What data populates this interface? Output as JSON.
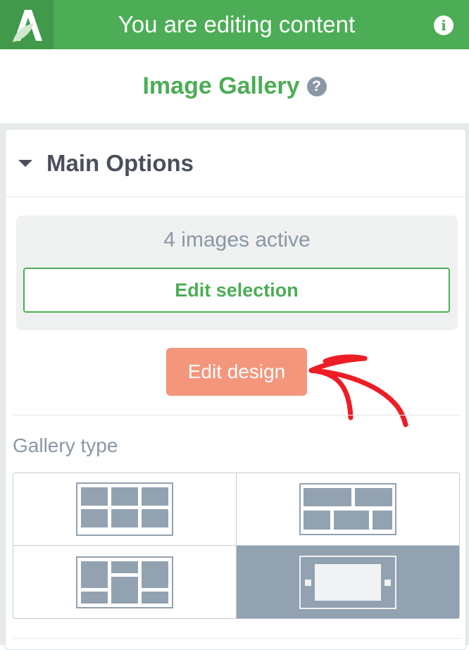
{
  "topbar": {
    "title": "You are editing content",
    "logo_icon": "leaf-a-logo-icon",
    "info_icon": "info-icon"
  },
  "header": {
    "title": "Image Gallery",
    "help_icon": "question-icon",
    "help_glyph": "?"
  },
  "main_options": {
    "section_title": "Main Options",
    "images_status": "4 images active",
    "edit_selection_label": "Edit selection",
    "edit_design_label": "Edit design",
    "gallery_type_label": "Gallery type",
    "gallery_types": [
      {
        "name": "grid",
        "selected": false
      },
      {
        "name": "masonry",
        "selected": false
      },
      {
        "name": "mosaic",
        "selected": false
      },
      {
        "name": "slider",
        "selected": true
      }
    ]
  },
  "colors": {
    "brand_green": "#4cad56",
    "edit_design_accent": "#f4967c",
    "annotation_red": "#ee1c25",
    "selected_option": "#93a2b0"
  }
}
